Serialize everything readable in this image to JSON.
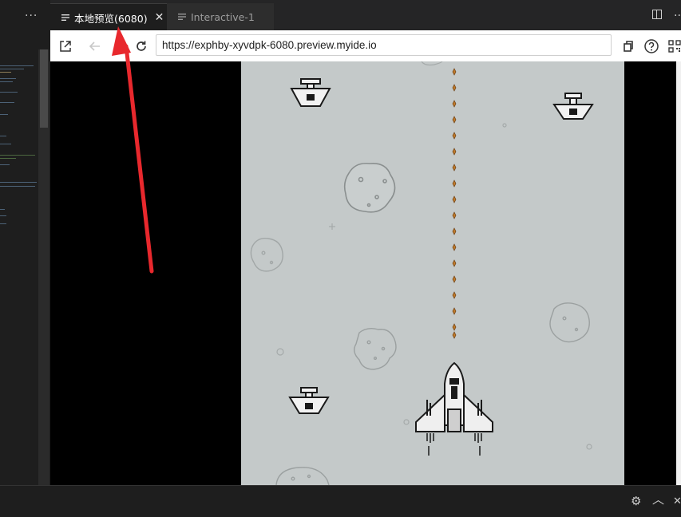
{
  "left_panel": {
    "more_label": "···"
  },
  "tabs": [
    {
      "label": "本地预览(6080)",
      "active": true,
      "close": "✕"
    },
    {
      "label": "Interactive-1",
      "active": false
    }
  ],
  "tab_more_label": "···",
  "toolbar": {
    "url": "https://exphby-xyvdpk-6080.preview.myide.io"
  },
  "icons": {
    "open_external": "open-external-icon",
    "back": "arrow-left-icon",
    "reload": "reload-icon",
    "screen": "screen-icon",
    "help": "question-icon",
    "qr": "qr-code-icon",
    "settings": "gear-icon",
    "chevron_up": "chevron-up-icon",
    "close": "close-icon"
  },
  "statusbar": {
    "settings_glyph": "⚙",
    "up_glyph": "︿",
    "close_glyph": "✕"
  },
  "colors": {
    "game_bg": "#c4c9c9",
    "bullet": "#c07a2a",
    "annotation_arrow": "#e8282d"
  }
}
